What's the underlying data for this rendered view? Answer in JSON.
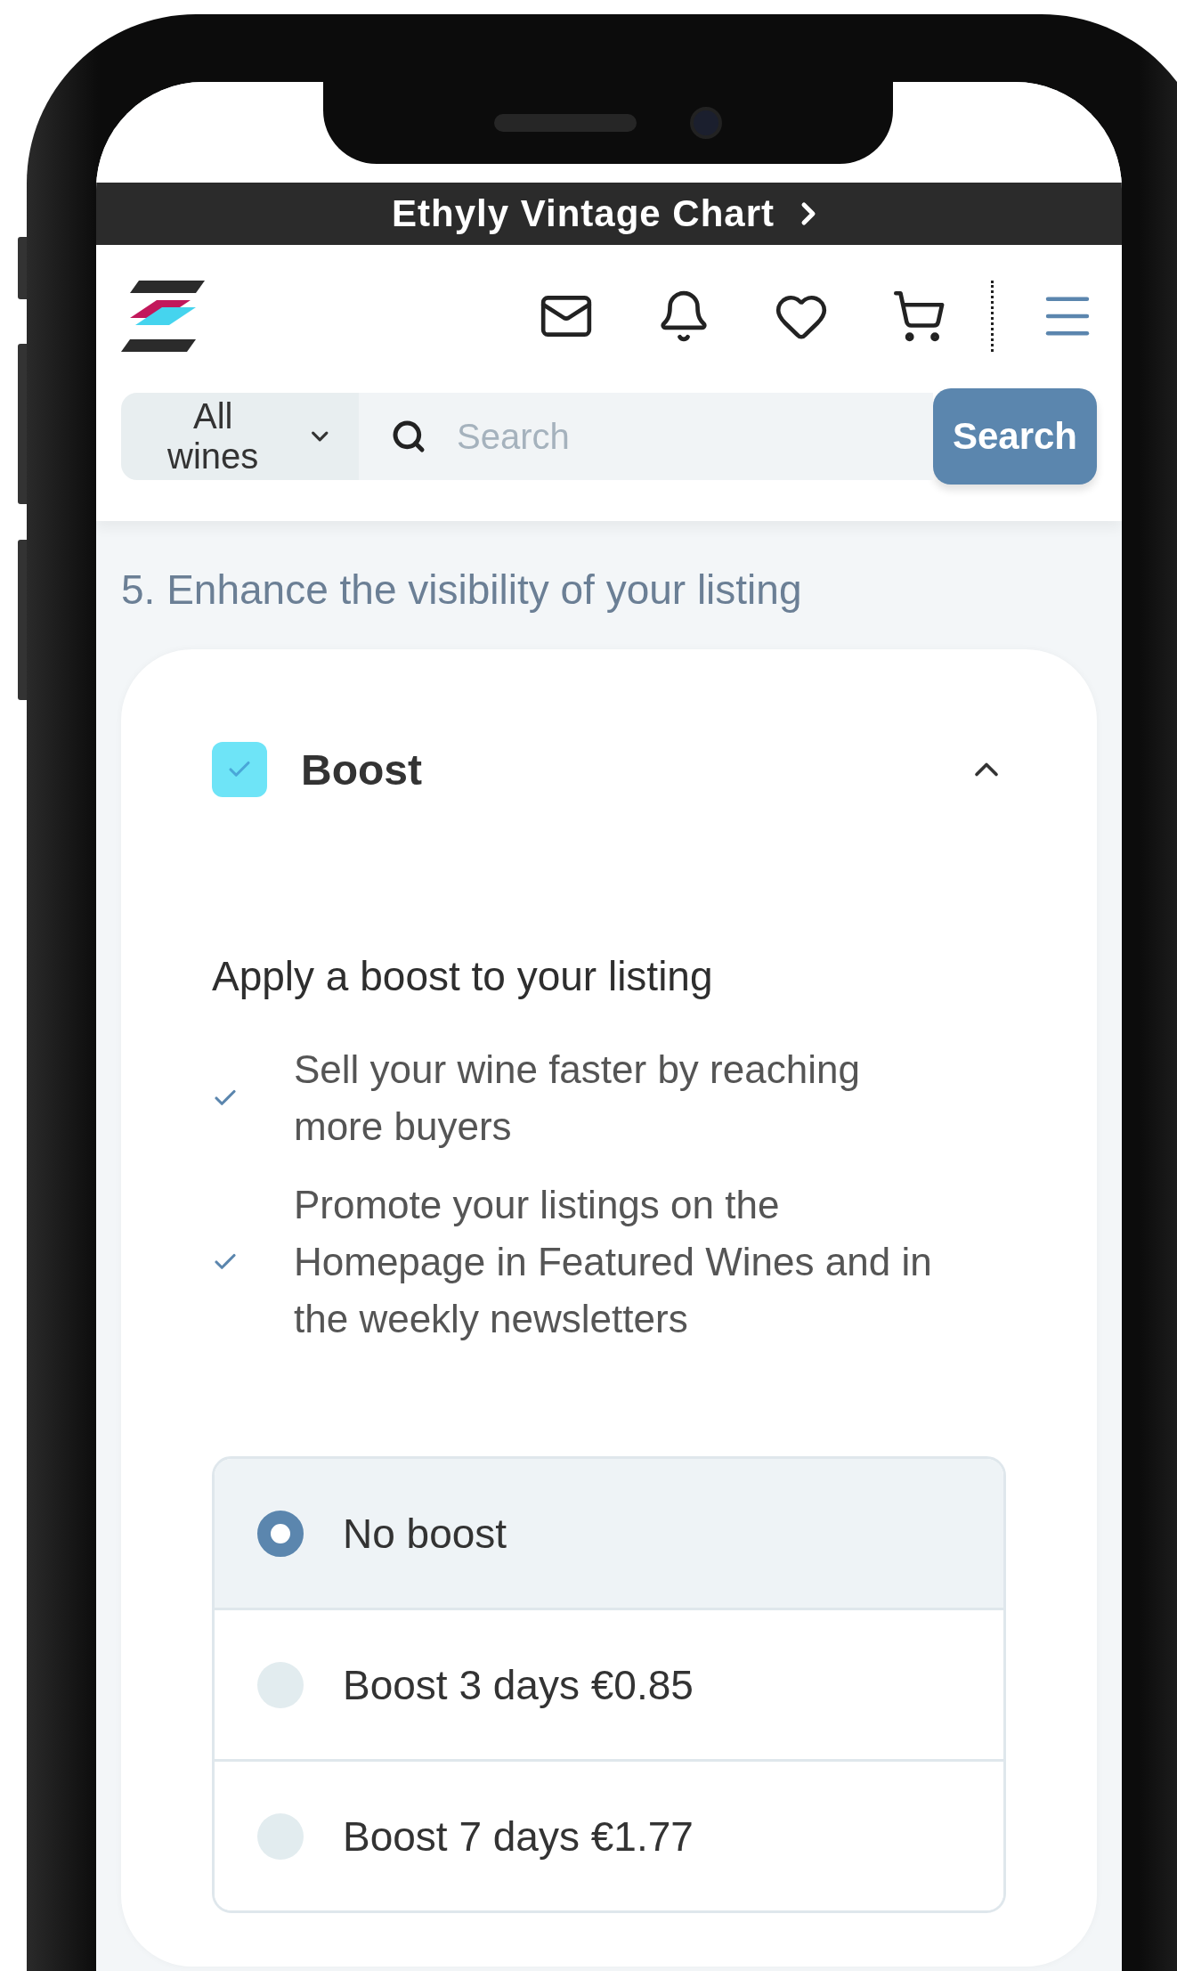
{
  "banner": {
    "title": "Ethyly Vintage Chart"
  },
  "search": {
    "category": "All wines",
    "placeholder": "Search",
    "button": "Search"
  },
  "section": {
    "heading": "5. Enhance the visibility of your listing"
  },
  "boost": {
    "title": "Boost",
    "checked": true,
    "expanded": true,
    "subtitle": "Apply a boost to your listing",
    "benefits": [
      "Sell your wine faster by reaching more buyers",
      "Promote your listings on the Homepage in Featured Wines and in the weekly newsletters"
    ],
    "options": [
      {
        "label": "No boost",
        "selected": true
      },
      {
        "label": "Boost 3 days €0.85",
        "selected": false
      },
      {
        "label": "Boost 7 days €1.77",
        "selected": false
      }
    ]
  }
}
